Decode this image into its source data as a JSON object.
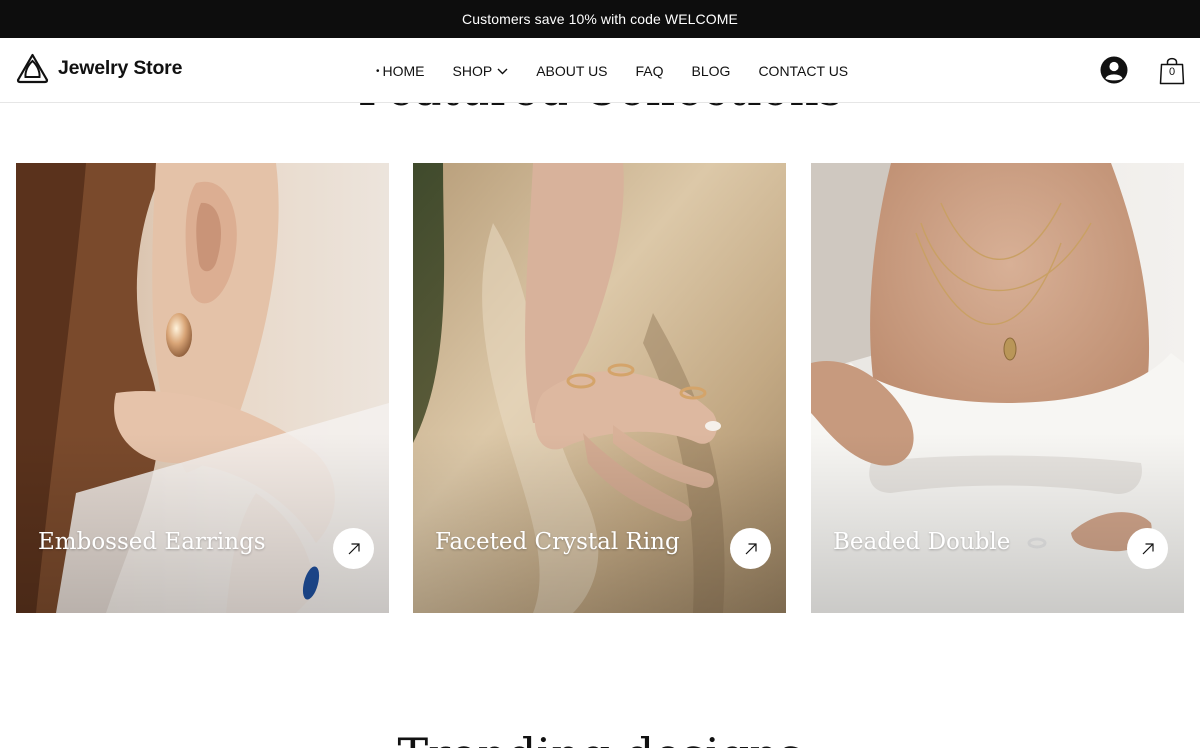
{
  "announcement": {
    "text": "Customers save 10% with code WELCOME"
  },
  "header": {
    "logo_text": "Jewelry Store",
    "logo_icon": "gem-outline-icon",
    "nav": [
      {
        "label": "HOME",
        "active": true
      },
      {
        "label": "SHOP",
        "dropdown": true
      },
      {
        "label": "ABOUT US"
      },
      {
        "label": "FAQ"
      },
      {
        "label": "BLOG"
      },
      {
        "label": "CONTACT US"
      }
    ],
    "account_icon": "user-avatar-icon",
    "cart_icon": "shopping-bag-icon",
    "cart_count": "0"
  },
  "featured": {
    "title": "Featured Collections",
    "collections": [
      {
        "label": "Embossed Earrings",
        "image": "woman-gold-earring-photo",
        "arrow_icon": "arrow-up-right-icon"
      },
      {
        "label": "Faceted Crystal Ring",
        "image": "hand-gold-rings-satin-photo",
        "arrow_icon": "arrow-up-right-icon"
      },
      {
        "label": "Beaded Double",
        "image": "woman-gold-necklace-pendant-photo",
        "arrow_icon": "arrow-up-right-icon"
      }
    ]
  },
  "trending": {
    "title": "Trending designs"
  },
  "colors": {
    "announcement_bg": "#0d0d0d",
    "text": "#111111",
    "header_border": "#e6e6e6",
    "card_label": "#ffffff"
  }
}
